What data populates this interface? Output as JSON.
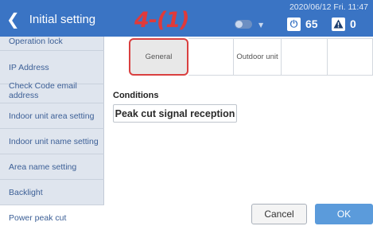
{
  "header": {
    "back_icon": "chevron-left",
    "title": "Initial setting",
    "step_label": "4-(1)",
    "datetime": "2020/06/12 Fri. 11:47",
    "power_count": "65",
    "alarm_count": "0",
    "colors": {
      "header_bg": "#3a74c4",
      "step_label": "#e03a3a"
    }
  },
  "sidebar": {
    "items": [
      {
        "label": "Operation lock"
      },
      {
        "label": "IP Address"
      },
      {
        "label": "Check Code email address"
      },
      {
        "label": "Indoor unit area setting"
      },
      {
        "label": "Indoor unit name setting"
      },
      {
        "label": "Area name setting"
      },
      {
        "label": "Backlight"
      },
      {
        "label": "Power peak cut",
        "active": true
      }
    ]
  },
  "tabs": [
    {
      "label": "General",
      "selected": true
    },
    {
      "label": ""
    },
    {
      "label": "Outdoor unit"
    },
    {
      "label": ""
    },
    {
      "label": ""
    }
  ],
  "conditions": {
    "title": "Conditions",
    "button_label": "Peak cut signal reception"
  },
  "footer": {
    "cancel_label": "Cancel",
    "ok_label": "OK"
  }
}
